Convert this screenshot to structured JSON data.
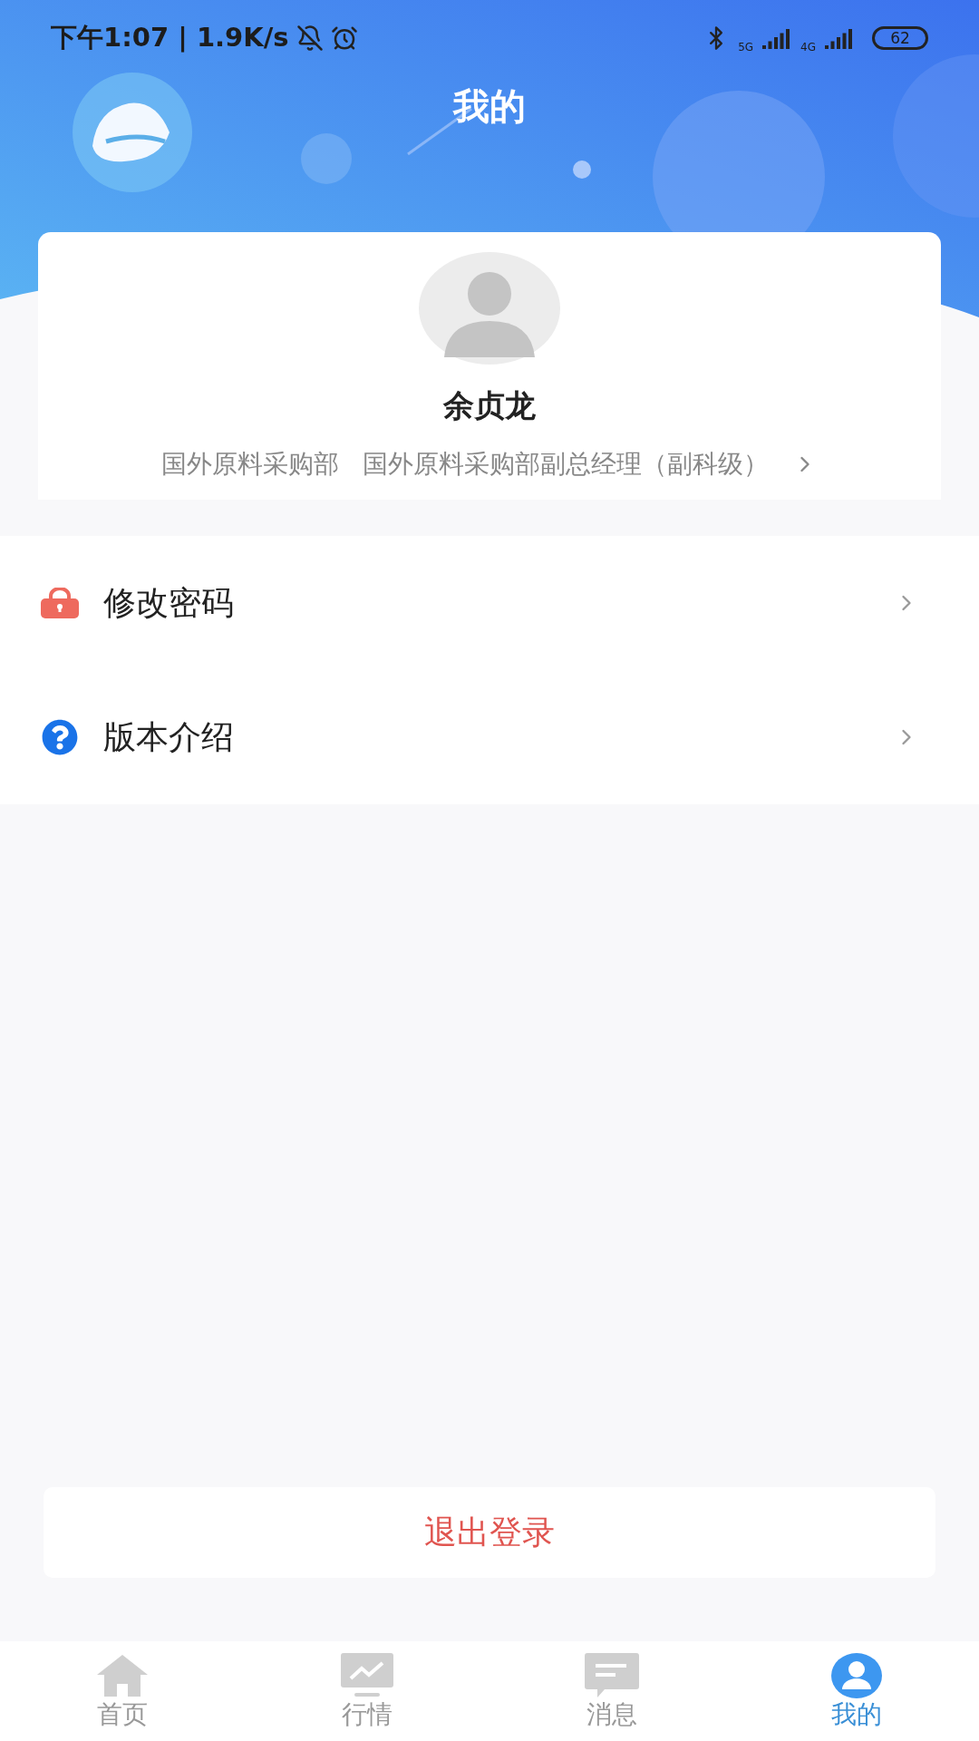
{
  "status_bar": {
    "time": "下午1:07 | 1.9K/s",
    "network_1": "5G",
    "network_2": "4G",
    "battery": "62"
  },
  "header": {
    "title": "我的"
  },
  "profile": {
    "name": "余贞龙",
    "department": "国外原料采购部",
    "position": "国外原料采购部副总经理（副科级）"
  },
  "menu": [
    {
      "kind": "password",
      "label": "修改密码"
    },
    {
      "kind": "about",
      "label": "版本介绍"
    }
  ],
  "logout_button": "退出登录",
  "tabs": [
    {
      "kind": "home",
      "label": "首页",
      "selected": false
    },
    {
      "kind": "market",
      "label": "行情",
      "selected": false
    },
    {
      "kind": "message",
      "label": "消息",
      "selected": false
    },
    {
      "kind": "profile",
      "label": "我的",
      "selected": true
    }
  ]
}
